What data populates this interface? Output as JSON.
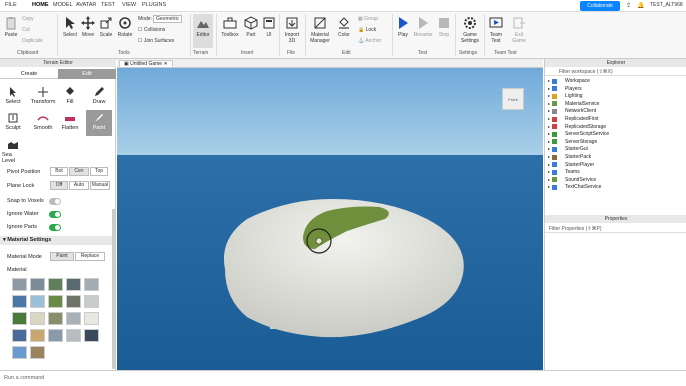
{
  "menubar": {
    "items": [
      "FILE",
      "HOME",
      "MODEL",
      "AVATAR",
      "TEST",
      "VIEW",
      "PLUGINS"
    ],
    "collaborate": "Collaborate",
    "user": "TEST_ALT968"
  },
  "ribbon": {
    "clipboard": {
      "paste": "Paste",
      "copy": "Copy",
      "cut": "Cut",
      "duplicate": "Duplicate",
      "label": "Clipboard"
    },
    "tools": {
      "select": "Select",
      "move": "Move",
      "scale": "Scale",
      "rotate": "Rotate",
      "mode_label": "Mode:",
      "mode_value": "Geometric",
      "collisions": "Collisions",
      "join": "Join Surfaces",
      "label": "Tools"
    },
    "terrain": {
      "editor": "Editor",
      "label": "Terrain"
    },
    "insert": {
      "toolbox": "Toolbox",
      "part": "Part",
      "ui": "UI",
      "label": "Insert"
    },
    "file": {
      "import": "Import",
      "import2": "3D",
      "label": "File"
    },
    "edit": {
      "material": "Material",
      "manager": "Manager",
      "color": "Color",
      "group": "Group",
      "lock": "Lock",
      "anchor": "Anchor",
      "label": "Edit"
    },
    "test": {
      "play": "Play",
      "resume": "Resume",
      "stop": "Stop",
      "label": "Test"
    },
    "settings": {
      "game": "Game",
      "settings": "Settings",
      "label": "Settings"
    },
    "teamtest": {
      "team": "Team",
      "test": "Test",
      "exit": "Exit",
      "game": "Game",
      "label": "Team Test"
    }
  },
  "terrain_editor": {
    "title": "Terrain Editor",
    "tabs": [
      "Create",
      "Edit"
    ],
    "tools": [
      "Select",
      "Transform",
      "Fill",
      "Draw",
      "Sculpt",
      "Smooth",
      "Flatten",
      "Paint",
      "Sea Level"
    ],
    "pivot_position": "Pivot Position",
    "pivot_options": [
      "Bot",
      "Cen",
      "Top"
    ],
    "plane_lock": "Plane Lock",
    "plane_options": [
      "Off",
      "Auto",
      "Manual"
    ],
    "snap": "Snap to Voxels",
    "ignore_water": "Ignore Water",
    "ignore_parts": "Ignore Parts",
    "material_settings": "Material Settings",
    "material_mode": "Material Mode",
    "mode_options": [
      "Paint",
      "Replace"
    ],
    "material": "Material"
  },
  "materials": [
    "#8e9aa6",
    "#7d8a99",
    "#5f7f5a",
    "#5a6a70",
    "#a3acb4",
    "#4c78a8",
    "#9cc0d8",
    "#6b8a4a",
    "#6f7468",
    "#c8cbcc",
    "#4a7a3a",
    "#d9d6c2",
    "#8a8d6a",
    "#a8b0b8",
    "#e8e8e0",
    "#4a6a9a",
    "#c8a870",
    "#8a9aa8",
    "#b8bcc0",
    "#3a4a5a",
    "#6a9ad0",
    "#9a8460"
  ],
  "viewport": {
    "tab": "Untitled Game",
    "cube": "Front"
  },
  "explorer": {
    "title": "Explorer",
    "filter": "Filter workspace (⇧⌘X)",
    "items": [
      "Workspace",
      "Players",
      "Lighting",
      "MaterialService",
      "NetworkClient",
      "ReplicatedFirst",
      "ReplicatedStorage",
      "ServerScriptService",
      "ServerStorage",
      "StarterGui",
      "StarterPack",
      "StarterPlayer",
      "Teams",
      "SoundService",
      "TextChatService"
    ],
    "colors": [
      "#3a7bd5",
      "#3a7bd5",
      "#e0a020",
      "#6a9a40",
      "#888888",
      "#d04040",
      "#d04040",
      "#3a9a3a",
      "#3a9a3a",
      "#3a7bd5",
      "#8a6a3a",
      "#3a7bd5",
      "#3a7bd5",
      "#6a9a40",
      "#3a7bd5"
    ]
  },
  "properties": {
    "title": "Properties",
    "filter": "Filter Properties (⇧⌘P)"
  },
  "command": {
    "placeholder": "Run a command"
  }
}
